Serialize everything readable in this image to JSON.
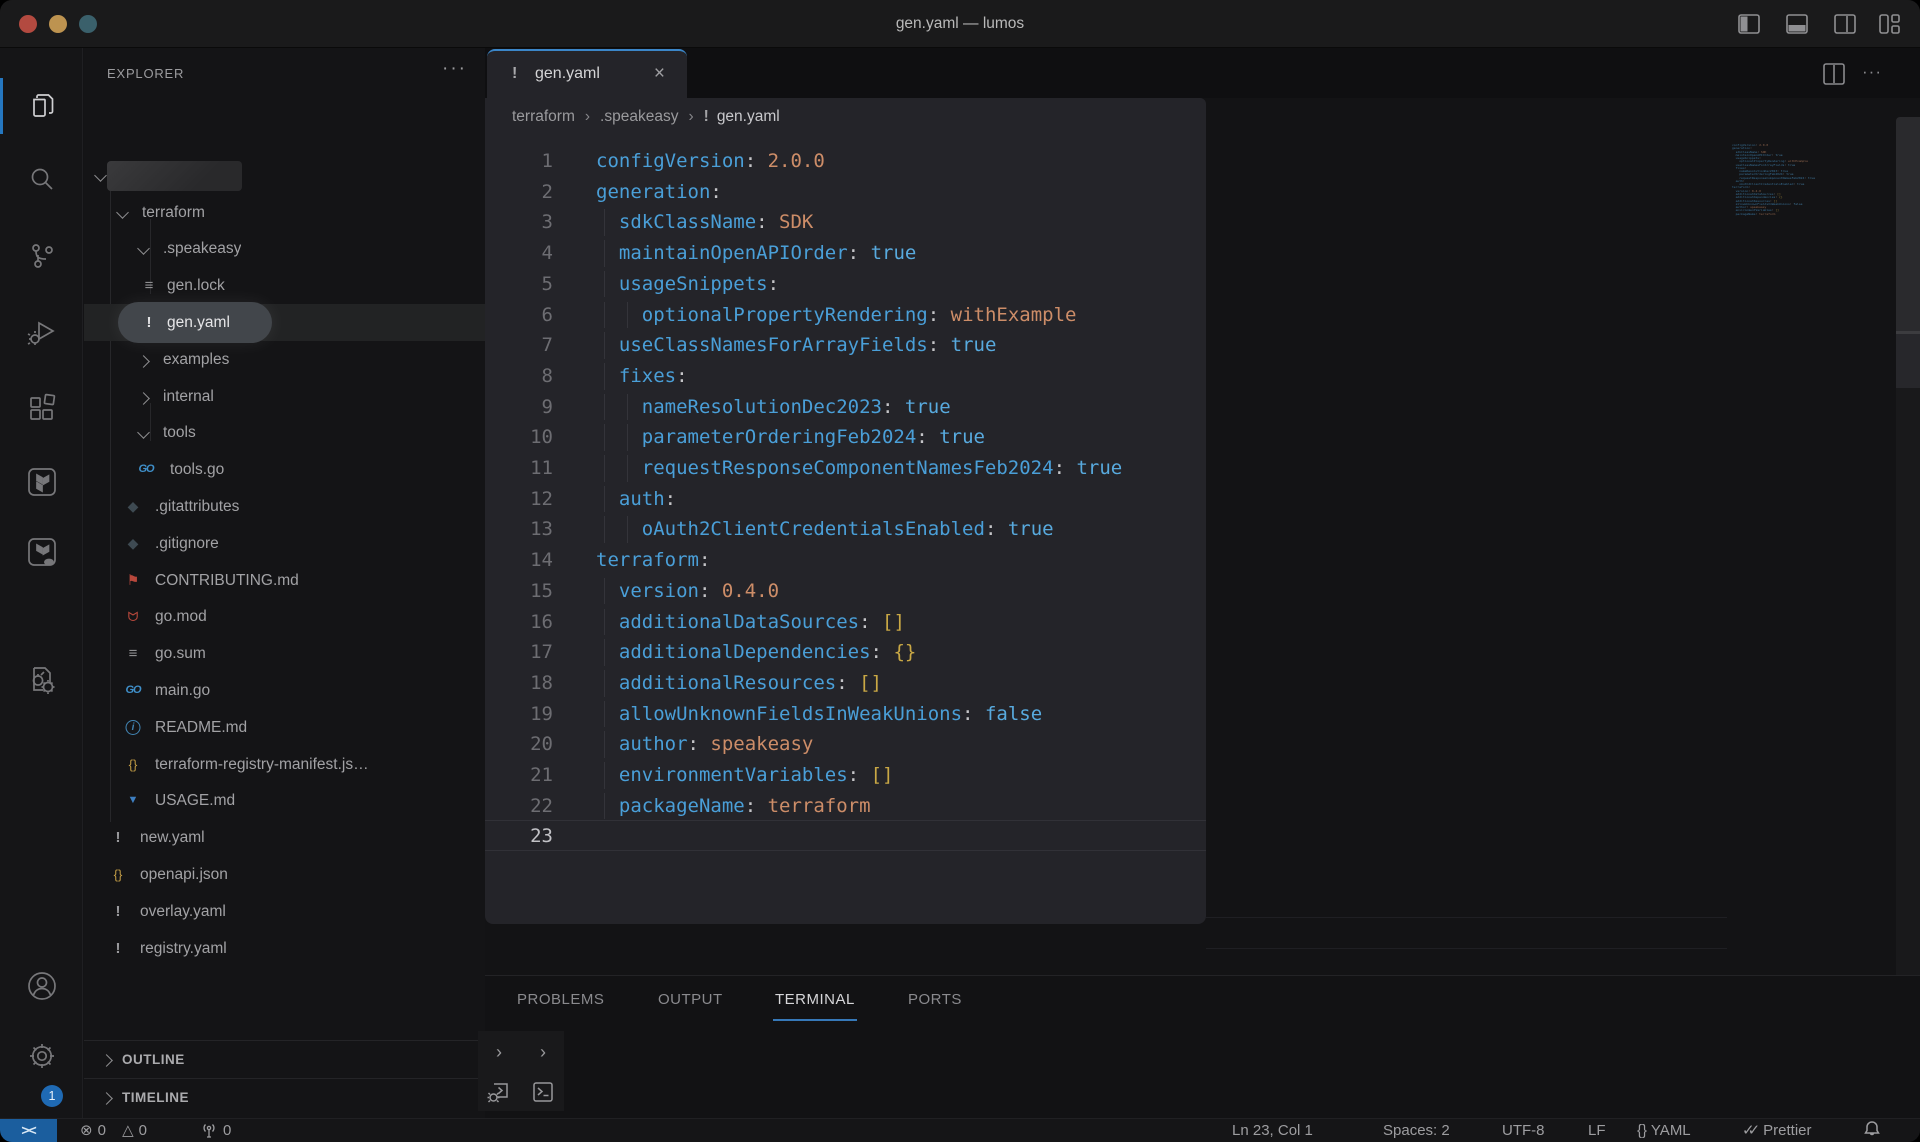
{
  "window": {
    "title": "gen.yaml — lumos"
  },
  "titlebar": {
    "icons": [
      "toggle-primary-sidebar",
      "toggle-panel",
      "toggle-secondary-sidebar",
      "customize-layout"
    ]
  },
  "activity": {
    "badge": "1"
  },
  "explorer": {
    "header": "EXPLORER",
    "header_actions": "···",
    "rows": [
      {
        "label": "",
        "kind": "workspace",
        "chevron": "down"
      },
      {
        "label": "terraform",
        "kind": "folder",
        "depth": 0,
        "chevron": "down"
      },
      {
        "label": ".speakeasy",
        "kind": "folder",
        "depth": 1,
        "chevron": "down"
      },
      {
        "label": "gen.lock",
        "kind": "file",
        "depth": 2,
        "icon": "list"
      },
      {
        "label": "gen.yaml",
        "kind": "file",
        "depth": 2,
        "icon": "warn",
        "selected": true
      },
      {
        "label": "examples",
        "kind": "folder",
        "depth": 1,
        "chevron": "right"
      },
      {
        "label": "internal",
        "kind": "folder",
        "depth": 1,
        "chevron": "right"
      },
      {
        "label": "tools",
        "kind": "folder",
        "depth": 1,
        "chevron": "down"
      },
      {
        "label": "tools.go",
        "kind": "file",
        "depth": 2,
        "icon": "go"
      },
      {
        "label": ".gitattributes",
        "kind": "file",
        "depth": 1,
        "icon": "git"
      },
      {
        "label": ".gitignore",
        "kind": "file",
        "depth": 1,
        "icon": "git"
      },
      {
        "label": "CONTRIBUTING.md",
        "kind": "file",
        "depth": 1,
        "icon": "contrib"
      },
      {
        "label": "go.mod",
        "kind": "file",
        "depth": 1,
        "icon": "feed"
      },
      {
        "label": "go.sum",
        "kind": "file",
        "depth": 1,
        "icon": "list"
      },
      {
        "label": "main.go",
        "kind": "file",
        "depth": 1,
        "icon": "go"
      },
      {
        "label": "README.md",
        "kind": "file",
        "depth": 1,
        "icon": "info"
      },
      {
        "label": "terraform-registry-manifest.js…",
        "kind": "file",
        "depth": 1,
        "icon": "json"
      },
      {
        "label": "USAGE.md",
        "kind": "file",
        "depth": 1,
        "icon": "down"
      },
      {
        "label": "new.yaml",
        "kind": "file",
        "depth": 0,
        "icon": "warn"
      },
      {
        "label": "openapi.json",
        "kind": "file",
        "depth": 0,
        "icon": "json"
      },
      {
        "label": "overlay.yaml",
        "kind": "file",
        "depth": 0,
        "icon": "warn"
      },
      {
        "label": "registry.yaml",
        "kind": "file",
        "depth": 0,
        "icon": "warn"
      }
    ],
    "sections": [
      "OUTLINE",
      "TIMELINE"
    ]
  },
  "editor": {
    "tab": {
      "label": "gen.yaml",
      "modified_icon": "!",
      "close": "×"
    },
    "breadcrumb": [
      "terraform",
      ".speakeasy",
      "gen.yaml"
    ],
    "breadcrumb_sep": "›",
    "lines": [
      {
        "n": "1",
        "tokens": [
          [
            "k",
            "configVersion"
          ],
          [
            "p",
            ":"
          ],
          [
            "s",
            " 2.0.0"
          ]
        ]
      },
      {
        "n": "2",
        "tokens": [
          [
            "k",
            "generation"
          ],
          [
            "p",
            ":"
          ]
        ]
      },
      {
        "n": "3",
        "tokens": [
          [
            "k",
            "  sdkClassName"
          ],
          [
            "p",
            ":"
          ],
          [
            "s",
            " SDK"
          ]
        ]
      },
      {
        "n": "4",
        "tokens": [
          [
            "k",
            "  maintainOpenAPIOrder"
          ],
          [
            "p",
            ":"
          ],
          [
            "b",
            " true"
          ]
        ]
      },
      {
        "n": "5",
        "tokens": [
          [
            "k",
            "  usageSnippets"
          ],
          [
            "p",
            ":"
          ]
        ]
      },
      {
        "n": "6",
        "tokens": [
          [
            "k",
            "    optionalPropertyRendering"
          ],
          [
            "p",
            ":"
          ],
          [
            "s",
            " withExample"
          ]
        ]
      },
      {
        "n": "7",
        "tokens": [
          [
            "k",
            "  useClassNamesForArrayFields"
          ],
          [
            "p",
            ":"
          ],
          [
            "b",
            " true"
          ]
        ]
      },
      {
        "n": "8",
        "tokens": [
          [
            "k",
            "  fixes"
          ],
          [
            "p",
            ":"
          ]
        ]
      },
      {
        "n": "9",
        "tokens": [
          [
            "k",
            "    nameResolutionDec2023"
          ],
          [
            "p",
            ":"
          ],
          [
            "b",
            " true"
          ]
        ]
      },
      {
        "n": "10",
        "tokens": [
          [
            "k",
            "    parameterOrderingFeb2024"
          ],
          [
            "p",
            ":"
          ],
          [
            "b",
            " true"
          ]
        ]
      },
      {
        "n": "11",
        "tokens": [
          [
            "k",
            "    requestResponseComponentNamesFeb2024"
          ],
          [
            "p",
            ":"
          ],
          [
            "b",
            " true"
          ]
        ]
      },
      {
        "n": "12",
        "tokens": [
          [
            "k",
            "  auth"
          ],
          [
            "p",
            ":"
          ]
        ]
      },
      {
        "n": "13",
        "tokens": [
          [
            "k",
            "    oAuth2ClientCredentialsEnabled"
          ],
          [
            "p",
            ":"
          ],
          [
            "b",
            " true"
          ]
        ]
      },
      {
        "n": "14",
        "tokens": [
          [
            "k",
            "terraform"
          ],
          [
            "p",
            ":"
          ]
        ]
      },
      {
        "n": "15",
        "tokens": [
          [
            "k",
            "  version"
          ],
          [
            "p",
            ":"
          ],
          [
            "s",
            " 0.4.0"
          ]
        ]
      },
      {
        "n": "16",
        "tokens": [
          [
            "k",
            "  additionalDataSources"
          ],
          [
            "p",
            ":"
          ],
          [
            "y",
            " []"
          ]
        ]
      },
      {
        "n": "17",
        "tokens": [
          [
            "k",
            "  additionalDependencies"
          ],
          [
            "p",
            ":"
          ],
          [
            "y",
            " {}"
          ]
        ]
      },
      {
        "n": "18",
        "tokens": [
          [
            "k",
            "  additionalResources"
          ],
          [
            "p",
            ":"
          ],
          [
            "y",
            " []"
          ]
        ]
      },
      {
        "n": "19",
        "tokens": [
          [
            "k",
            "  allowUnknownFieldsInWeakUnions"
          ],
          [
            "p",
            ":"
          ],
          [
            "b",
            " false"
          ]
        ]
      },
      {
        "n": "20",
        "tokens": [
          [
            "k",
            "  author"
          ],
          [
            "p",
            ":"
          ],
          [
            "s",
            " speakeasy"
          ]
        ]
      },
      {
        "n": "21",
        "tokens": [
          [
            "k",
            "  environmentVariables"
          ],
          [
            "p",
            ":"
          ],
          [
            "y",
            " []"
          ]
        ]
      },
      {
        "n": "22",
        "tokens": [
          [
            "k",
            "  packageName"
          ],
          [
            "p",
            ":"
          ],
          [
            "s",
            " terraform"
          ]
        ]
      },
      {
        "n": "23",
        "tokens": [],
        "current": true
      }
    ]
  },
  "panel": {
    "tabs": [
      {
        "label": "PROBLEMS",
        "active": false
      },
      {
        "label": "OUTPUT",
        "active": false
      },
      {
        "label": "TERMINAL",
        "active": true
      },
      {
        "label": "PORTS",
        "active": false
      }
    ]
  },
  "status": {
    "remote_label": "><",
    "errors": "0",
    "warnings": "0",
    "broadcast": "0",
    "cursor": "Ln 23, Col 1",
    "indent": "Spaces: 2",
    "encoding": "UTF-8",
    "eol": "LF",
    "language": "{} YAML",
    "formatter": "Prettier"
  },
  "colors": {
    "accent_blue": "#3b86c8",
    "remote_blue": "#1b5e9e",
    "key_blue": "#4a9fd8",
    "value_orange": "#cd8d68",
    "bracket_yellow": "#c9a845"
  }
}
